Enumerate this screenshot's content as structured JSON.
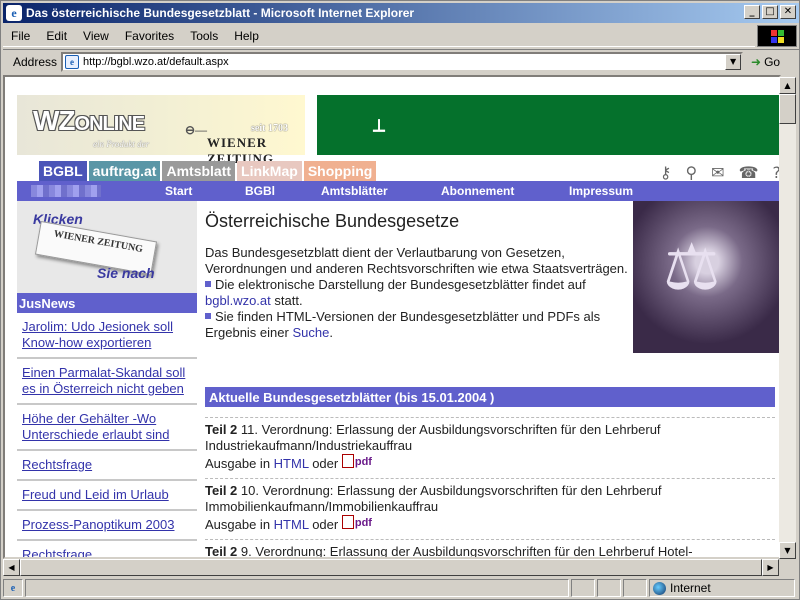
{
  "window": {
    "title": "Das österreichische Bundesgesetzblatt - Microsoft Internet Explorer",
    "controls": [
      "_",
      "□",
      "✕"
    ]
  },
  "menu": {
    "items": [
      {
        "label": "File"
      },
      {
        "label": "Edit"
      },
      {
        "label": "View"
      },
      {
        "label": "Favorites"
      },
      {
        "label": "Tools"
      },
      {
        "label": "Help"
      }
    ]
  },
  "address": {
    "label": "Address",
    "url": "http://bgbl.wzo.at/default.aspx",
    "go_label": "Go"
  },
  "banner": {
    "logo_main": "WZ",
    "logo_rest": "ONLINE",
    "logo_sub": "ein Produkt der",
    "paper_name": "WIENER ZEITUNG",
    "seit": "seit 1703"
  },
  "tabs": [
    {
      "label": "BGBL",
      "color": "#4b55b8"
    },
    {
      "label": "auftrag.at",
      "color": "#5a96a6"
    },
    {
      "label": "Amtsblatt",
      "color": "#9a9a9a"
    },
    {
      "label": "LinkMap",
      "color": "#e8c8c0"
    },
    {
      "label": "Shopping",
      "color": "#f0b090"
    }
  ],
  "nav": {
    "items": [
      {
        "label": "Start"
      },
      {
        "label": "BGBl"
      },
      {
        "label": "Amtsblätter"
      },
      {
        "label": "Abonnement"
      },
      {
        "label": "Impressum"
      }
    ]
  },
  "promo": {
    "line1": "Klicken",
    "paper": "WIENER ZEITUNG",
    "line2": "Sie nach"
  },
  "jusnews": {
    "heading": "JusNews",
    "items": [
      {
        "text": "Jarolim: Udo Jesionek soll Know-how exportieren"
      },
      {
        "text": "Einen Parmalat-Skandal soll es in Österreich nicht geben"
      },
      {
        "text": "Höhe der Gehälter -Wo Unterschiede erlaubt sind"
      },
      {
        "text": "Rechtsfrage"
      },
      {
        "text": "Freud und Leid im Urlaub"
      },
      {
        "text": "Prozess-Panoptikum 2003"
      },
      {
        "text": "Rechtsfrage"
      }
    ]
  },
  "main": {
    "heading": "Österreichische Bundesgesetze",
    "intro": "Das Bundesgesetzblatt dient der Verlautbarung von Gesetzen, Verordnungen und anderen Rechtsvorschriften wie etwa Staatsverträgen.",
    "bullet1_pre": "Die elektronische Darstellung der Bundesgesetzblätter findet auf ",
    "bullet1_link": "bgbl.wzo.at",
    "bullet1_post": " statt.",
    "bullet2_pre": "Sie finden HTML-Versionen der Bundesgesetzblätter und PDFs als Ergebnis einer ",
    "bullet2_link": "Suche",
    "bullet2_post": "."
  },
  "aktuell": {
    "heading": "Aktuelle Bundesgesetzblätter (bis 15.01.2004 )"
  },
  "entries": [
    {
      "teil": "Teil 2",
      "text": "11. Verordnung: Erlassung der Ausbildungsvorschriften für den Lehrberuf Industriekaufmann/Industriekauffrau",
      "ausgabe": "Ausgabe in ",
      "html": "HTML ",
      "oder": "oder",
      "pdf": "pdf"
    },
    {
      "teil": "Teil 2",
      "text": "10. Verordnung: Erlassung der Ausbildungsvorschriften für den Lehrberuf Immobilienkaufmann/Immobilienkauffrau",
      "ausgabe": "Ausgabe in ",
      "html": "HTML ",
      "oder": "oder",
      "pdf": "pdf"
    },
    {
      "teil": "Teil 2",
      "text": "9. Verordnung: Erlassung der Ausbildungsvorschriften für den Lehrberuf Hotel-",
      "ausgabe": "",
      "html": "",
      "oder": "",
      "pdf": ""
    }
  ],
  "status": {
    "zone": "Internet"
  }
}
